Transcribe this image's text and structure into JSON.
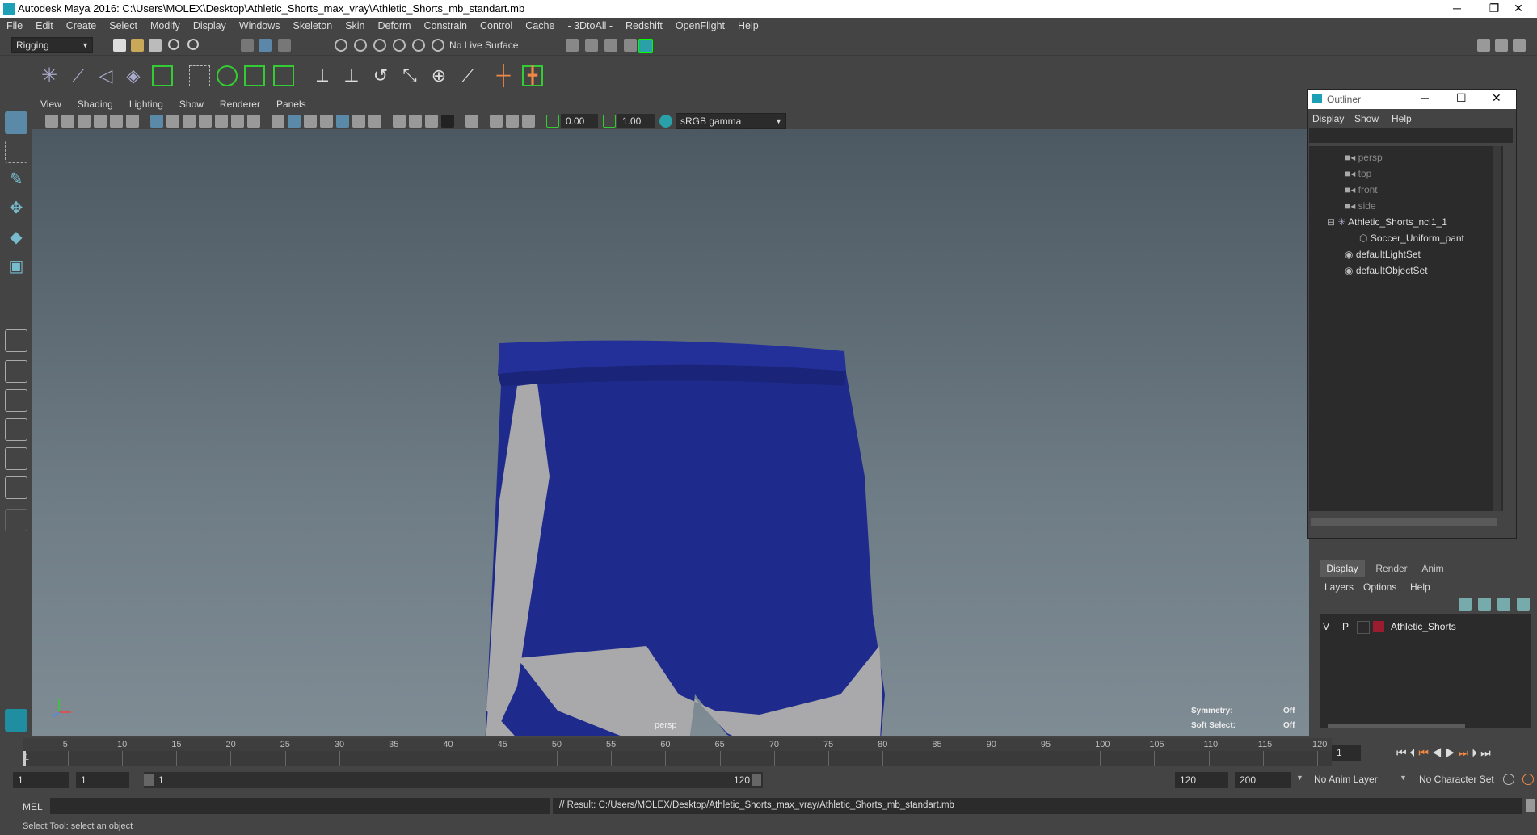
{
  "window": {
    "title": "Autodesk Maya 2016: C:\\Users\\MOLEX\\Desktop\\Athletic_Shorts_max_vray\\Athletic_Shorts_mb_standart.mb",
    "minimize": "─",
    "restore": "❐",
    "close": "✕"
  },
  "menubar": [
    "File",
    "Edit",
    "Create",
    "Select",
    "Modify",
    "Display",
    "Windows",
    "Skeleton",
    "Skin",
    "Deform",
    "Constrain",
    "Control",
    "Cache",
    "- 3DtoAll -",
    "Redshift",
    "OpenFlight",
    "Help"
  ],
  "statusline": {
    "menuset": "Rigging",
    "live_surface": "No Live Surface"
  },
  "viewport": {
    "menus": [
      "View",
      "Shading",
      "Lighting",
      "Show",
      "Renderer",
      "Panels"
    ],
    "exposure": "0.00",
    "gamma": "1.00",
    "colorspace": "sRGB gamma",
    "camera_label": "persp",
    "symmetry_label": "Symmetry:",
    "symmetry_value": "Off",
    "softselect_label": "Soft Select:",
    "softselect_value": "Off",
    "colors": {
      "shorts_blue": "#1f2b8c",
      "shorts_gray": "#a9a9ab"
    }
  },
  "outliner": {
    "title": "Outliner",
    "menus": [
      "Display",
      "Show",
      "Help"
    ],
    "items": [
      {
        "label": "persp",
        "kind": "camera",
        "dim": true
      },
      {
        "label": "top",
        "kind": "camera",
        "dim": true
      },
      {
        "label": "front",
        "kind": "camera",
        "dim": true
      },
      {
        "label": "side",
        "kind": "camera",
        "dim": true
      },
      {
        "label": "Athletic_Shorts_ncl1_1",
        "kind": "group",
        "dim": false
      },
      {
        "label": "Soccer_Uniform_pant",
        "kind": "mesh",
        "dim": false
      },
      {
        "label": "defaultLightSet",
        "kind": "set",
        "dim": false
      },
      {
        "label": "defaultObjectSet",
        "kind": "set",
        "dim": false
      }
    ]
  },
  "layers": {
    "tabs": [
      "Display",
      "Render",
      "Anim"
    ],
    "menus": [
      "Layers",
      "Options",
      "Help"
    ],
    "row": {
      "v": "V",
      "p": "P",
      "name": "Athletic_Shorts",
      "color": "#9b1c2e"
    }
  },
  "timeslider": {
    "ticks": [
      "5",
      "10",
      "15",
      "20",
      "25",
      "30",
      "35",
      "40",
      "45",
      "50",
      "55",
      "60",
      "65",
      "70",
      "75",
      "80",
      "85",
      "90",
      "95",
      "100",
      "105",
      "110",
      "115",
      "120"
    ],
    "start_tick": "1",
    "current_frame": "1"
  },
  "range": {
    "start": "1",
    "playback_start": "1",
    "slider_start": "1",
    "slider_end": "120",
    "playback_end": "120",
    "end": "200",
    "anim_layer": "No Anim Layer",
    "character_set": "No Character Set"
  },
  "cmdline": {
    "lang": "MEL",
    "result": "// Result: C:/Users/MOLEX/Desktop/Athletic_Shorts_max_vray/Athletic_Shorts_mb_standart.mb"
  },
  "helpline": "Select Tool: select an object"
}
